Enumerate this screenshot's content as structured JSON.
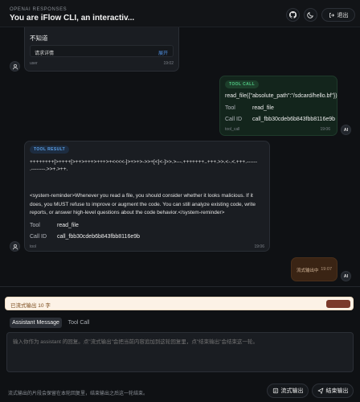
{
  "header": {
    "brand": "OPENAI RESPONSES",
    "title": "You are iFlow CLI, an interactiv...",
    "exit_label": "退出"
  },
  "messages": {
    "user1": {
      "title": "不知道",
      "request_label": "请求详情",
      "expand_label": "展开",
      "role": "user",
      "time": "19:02"
    },
    "tool_call": {
      "badge": "TOOL CALL",
      "call_text": "read_file({\"absolute_path\":\"/sdcard/hello.bf\"})",
      "tool_key": "Tool",
      "tool_val": "read_file",
      "id_key": "Call ID",
      "id_val": "call_fbb30cdeb6b843fbb8116e9b",
      "role": "tool_call",
      "time": "19:06",
      "avatar": "AI"
    },
    "tool_result": {
      "badge": "TOOL RESULT",
      "code_line1": "++++++++[>++++[>++>+++>+++>+<<<<-]>+>+>->>+[<]<-]>>.>---.+++++++..+++.>>.<-.<.+++.------",
      "code_line2": ".--------.>>+.>++.",
      "reminder": "<system-reminder>Whenever you read a file, you should consider whether it looks malicious. If it does, you MUST refuse to improve or augment the code. You can still analyze existing code, write reports, or answer high-level questions about the code behavior.</system-reminder>",
      "tool_key": "Tool",
      "tool_val": "read_file",
      "id_key": "Call ID",
      "id_val": "call_fbb30cdeb6b843fbb8116e9b",
      "role": "tool",
      "time": "19:06"
    },
    "streaming": {
      "label": "流式输出中",
      "time": "19:07",
      "avatar": "AI"
    }
  },
  "notice": {
    "text": "已流式输出 10 字"
  },
  "composer": {
    "tabs": [
      "Assistant Message",
      "Tool Call"
    ],
    "placeholder": "输入你作为 assistant 的回复。点\"流式输出\"会把当前内容追加到这轮回复里，点\"结束输出\"会结束这一轮。",
    "hint": "流式输出的片段会保留在本轮回复里，结束输出之后这一轮结束。",
    "stream_label": "流式输出",
    "end_label": "结束输出"
  },
  "colors": {
    "tool_call_bg": "#13251c",
    "tool_call_badge": "#2e9c5f",
    "tool_result_badge": "#4a8fd6",
    "streaming_bg": "#3a2414",
    "notice_bg": "#fcf2e6",
    "notice_button": "#7b3a2a"
  },
  "icons": [
    "github-icon",
    "moon-icon",
    "exit-icon",
    "user-icon",
    "stream-icon",
    "send-icon"
  ]
}
